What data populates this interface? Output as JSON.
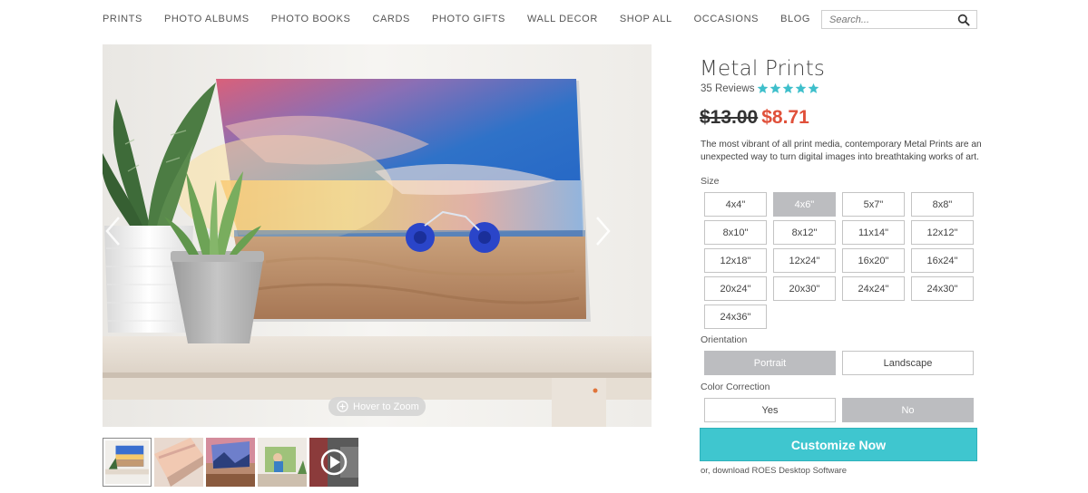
{
  "nav": {
    "items": [
      "PRINTS",
      "PHOTO ALBUMS",
      "PHOTO BOOKS",
      "CARDS",
      "PHOTO GIFTS",
      "WALL DECOR",
      "SHOP ALL",
      "OCCASIONS",
      "BLOG"
    ],
    "search_placeholder": "Search..."
  },
  "gallery": {
    "zoom_hint": "Hover to Zoom",
    "thumbnails": [
      "metal-print-on-table",
      "metal-print-angle",
      "metal-print-mountains",
      "metal-print-family",
      "product-video"
    ]
  },
  "product": {
    "title": "Metal Prints",
    "reviews_label": "35 Reviews",
    "rating": 5,
    "star_color": "#3fbfcb",
    "price_old": "$13.00",
    "price_new": "$8.71",
    "price_new_color": "#e0503a",
    "description": "The most vibrant of all print media, contemporary Metal Prints are an unexpected way to turn digital images into breathtaking works of art."
  },
  "options": {
    "size_label": "Size",
    "sizes": [
      "4x4\"",
      "4x6\"",
      "5x7\"",
      "8x8\"",
      "8x10\"",
      "8x12\"",
      "11x14\"",
      "12x12\"",
      "12x18\"",
      "12x24\"",
      "16x20\"",
      "16x24\"",
      "20x24\"",
      "20x30\"",
      "24x24\"",
      "24x30\"",
      "24x36\""
    ],
    "selected_size": "4x6\"",
    "orientation_label": "Orientation",
    "orientations": [
      "Portrait",
      "Landscape"
    ],
    "selected_orientation": "Portrait",
    "color_correction_label": "Color Correction",
    "color_correction": [
      "Yes",
      "No"
    ],
    "selected_color_correction": "No"
  },
  "actions": {
    "customize_label": "Customize Now",
    "customize_color": "#3fc6cf",
    "roes_text": "or, download ROES Desktop Software"
  }
}
